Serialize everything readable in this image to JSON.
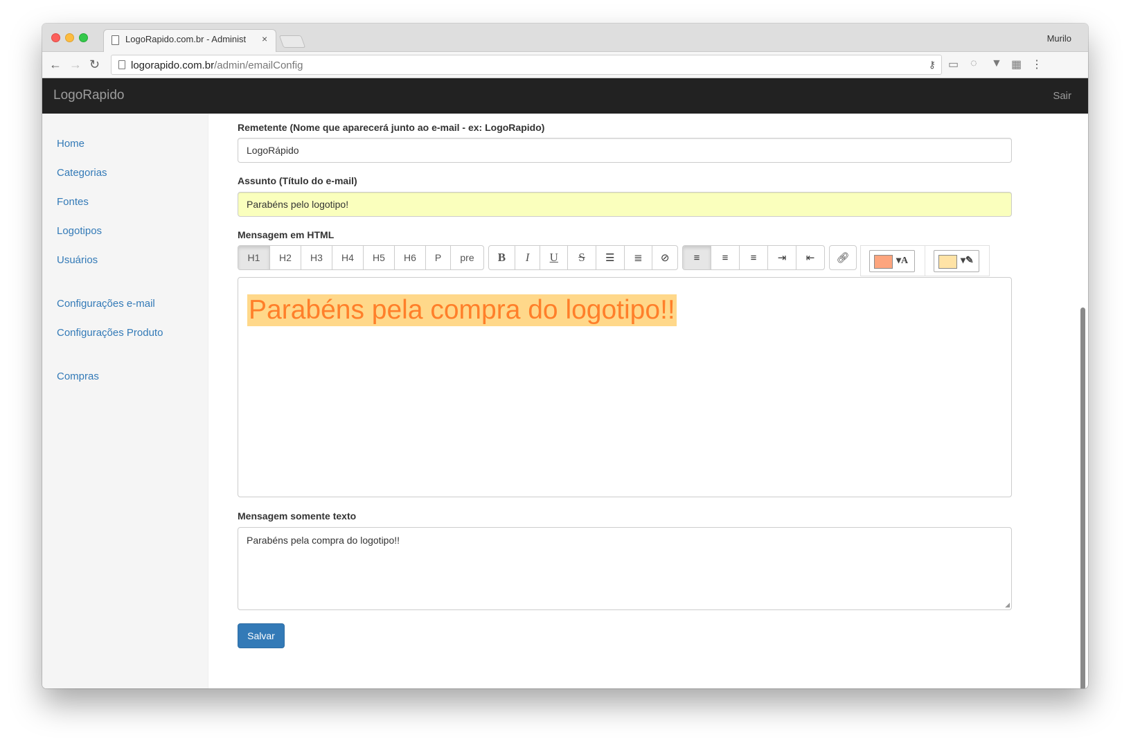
{
  "browser": {
    "tab_title": "LogoRapido.com.br - Administ",
    "tab_close": "×",
    "profile": "Murilo",
    "url_host": "logorapido.com.br",
    "url_path": "/admin/emailConfig"
  },
  "navbar": {
    "brand": "LogoRapido",
    "logout": "Sair"
  },
  "sidebar": {
    "items": [
      {
        "label": "Home"
      },
      {
        "label": "Categorias"
      },
      {
        "label": "Fontes"
      },
      {
        "label": "Logotipos"
      },
      {
        "label": "Usuários"
      },
      {
        "label": "Configurações e-mail"
      },
      {
        "label": "Configurações Produto"
      },
      {
        "label": "Compras"
      }
    ]
  },
  "form": {
    "sender_label": "Remetente (Nome que aparecerá junto ao e-mail - ex: LogoRapido)",
    "sender_value": "LogoRápido",
    "subject_label": "Assunto (Título do e-mail)",
    "subject_value": "Parabéns pelo logotipo!",
    "html_label": "Mensagem em HTML",
    "html_content": "Parabéns pela compra do logotipo!!",
    "text_label": "Mensagem somente texto",
    "text_value": "Parabéns pela compra do logotipo!!",
    "save_label": "Salvar"
  },
  "editor_toolbar": {
    "headings": [
      "H1",
      "H2",
      "H3",
      "H4",
      "H5",
      "H6",
      "P",
      "pre"
    ],
    "active_heading": "H1",
    "format": [
      "B",
      "I",
      "U",
      "S"
    ],
    "list_icons": [
      "bullet-list-icon",
      "numbered-list-icon",
      "clear-format-icon"
    ],
    "align_icons": [
      "align-left-icon",
      "align-center-icon",
      "align-right-icon",
      "indent-icon",
      "outdent-icon"
    ],
    "link_icon": "link-icon",
    "text_color": "#fda57e",
    "highlight_color": "#ffe3a6"
  },
  "colors": {
    "accent": "#337ab7",
    "navbar_bg": "#222222",
    "editor_text": "#ff7f2a",
    "editor_highlight": "#ffd88a",
    "autofill_bg": "#faffbd"
  }
}
